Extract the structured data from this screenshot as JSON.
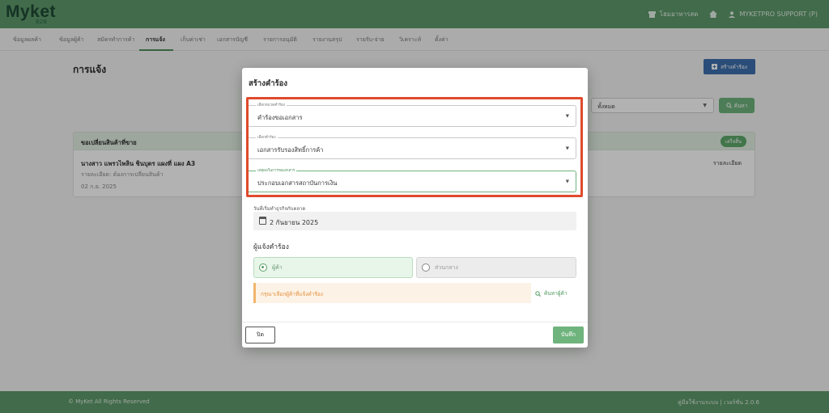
{
  "app": {
    "logo": "Myket",
    "logo_sub": "B2B"
  },
  "topbar": {
    "home_label": "โฮมอาหารสด",
    "user_label": "MYKETPRO SUPPORT (P)"
  },
  "nav": {
    "tabs": [
      {
        "label": "ข้อมูลผลค้า",
        "active": false
      },
      {
        "label": "ข้อมูลผู้ค้า",
        "active": false
      },
      {
        "label": "สมัครทำการค้า",
        "active": false
      },
      {
        "label": "การแจ้ง",
        "active": true
      },
      {
        "label": "เก็บค่าเช่า",
        "active": false
      },
      {
        "label": "เอกสารบัญชี",
        "active": false
      },
      {
        "label": "รายการอนุมัติ",
        "active": false
      },
      {
        "label": "รายงานสรุป",
        "active": false
      },
      {
        "label": "รายรับ-จ่าย",
        "active": false
      },
      {
        "label": "วิเคราะห์",
        "active": false
      },
      {
        "label": "ตั้งค่า",
        "active": false
      }
    ]
  },
  "page": {
    "title": "การแจ้ง",
    "create_button": "สร้างคำร้อง",
    "filter_value": "ทั้งหมด",
    "search_button": "ค้นหา"
  },
  "card": {
    "title": "ขอเปลี่ยนสินค้าที่ขาย",
    "badge": "เสร็จสิ้น",
    "name": "นางสาว แพรวไพลิน ชินบุตร แผงที่ แผง A3",
    "description": "รายละเอียด: ต้องการเปลี่ยนสินค้า",
    "date": "02 ก.ย. 2025",
    "detail_link": "รายละเอียด"
  },
  "footer": {
    "copyright": "© MyKet All Rights Reserved",
    "version": "คู่มือใช้งานระบบ | เวอร์ชั่น 2.0.6"
  },
  "modal": {
    "title": "สร้างคำร้อง",
    "fields": [
      {
        "label": "เลือกหมวดคำร้อง",
        "value": "คำร้องขอเอกสาร"
      },
      {
        "label": "เลือกคำร้อง",
        "value": "เอกสารรับรองสิทธิ์การค้า"
      },
      {
        "label": "เหตุผลในการขอเอกสาร",
        "value": "ประกอบเอกสารสถาบันการเงิน"
      }
    ],
    "date_label": "วันที่เริ่มทำธุรกิจกับตลาด",
    "date_value": "2 กันยายน 2025",
    "requester_title": "ผู้แจ้งคำร้อง",
    "options": [
      {
        "label": "ผู้ค้า",
        "checked": true
      },
      {
        "label": "ส่วนกลาง",
        "checked": false
      }
    ],
    "warning": "กรุณาเลือกผู้ค้าที่แจ้งคำร้อง",
    "find_vendor": "ค้นหาผู้ค้า",
    "close_button": "ปิด",
    "save_button": "บันทึก"
  },
  "colors": {
    "brand": "#5e9a6a",
    "highlight": "#e04a2c",
    "primary": "#6fb37d"
  }
}
